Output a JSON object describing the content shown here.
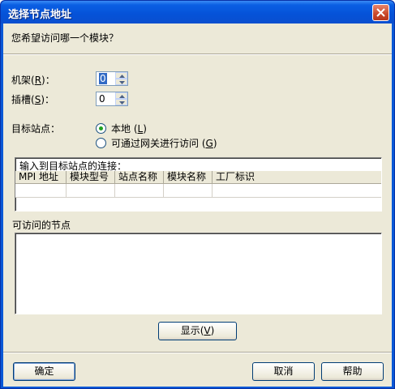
{
  "window": {
    "title": "选择节点地址"
  },
  "prompt": "您希望访问哪一个模块？",
  "rack": {
    "label": "机架",
    "hotkey_open": "(",
    "hotkey": "R",
    "hotkey_close": ")",
    "colon": "：",
    "value": "0"
  },
  "slot": {
    "label": "插槽",
    "hotkey_open": "(",
    "hotkey": "S",
    "hotkey_close": ")",
    "colon": "：",
    "value": "0"
  },
  "target_station": {
    "label": "目标站点：",
    "options": [
      {
        "label": "本地",
        "hotkey": "L",
        "selected": true
      },
      {
        "label": "可通过网关进行访问",
        "hotkey": "G",
        "selected": false
      }
    ]
  },
  "connection": {
    "title": "输入到目标站点的连接：",
    "columns": [
      "MPI 地址",
      "模块型号",
      "站点名称",
      "模块名称",
      "工厂标识"
    ]
  },
  "accessible_nodes": {
    "label": "可访问的节点"
  },
  "buttons": {
    "show": "显示",
    "show_hotkey": "V",
    "ok": "确定",
    "cancel": "取消",
    "help": "帮助"
  },
  "colors": {
    "title_bar": "#0a5fe3",
    "dialog_bg": "#ece9d8",
    "radio_dot": "#21a121"
  }
}
